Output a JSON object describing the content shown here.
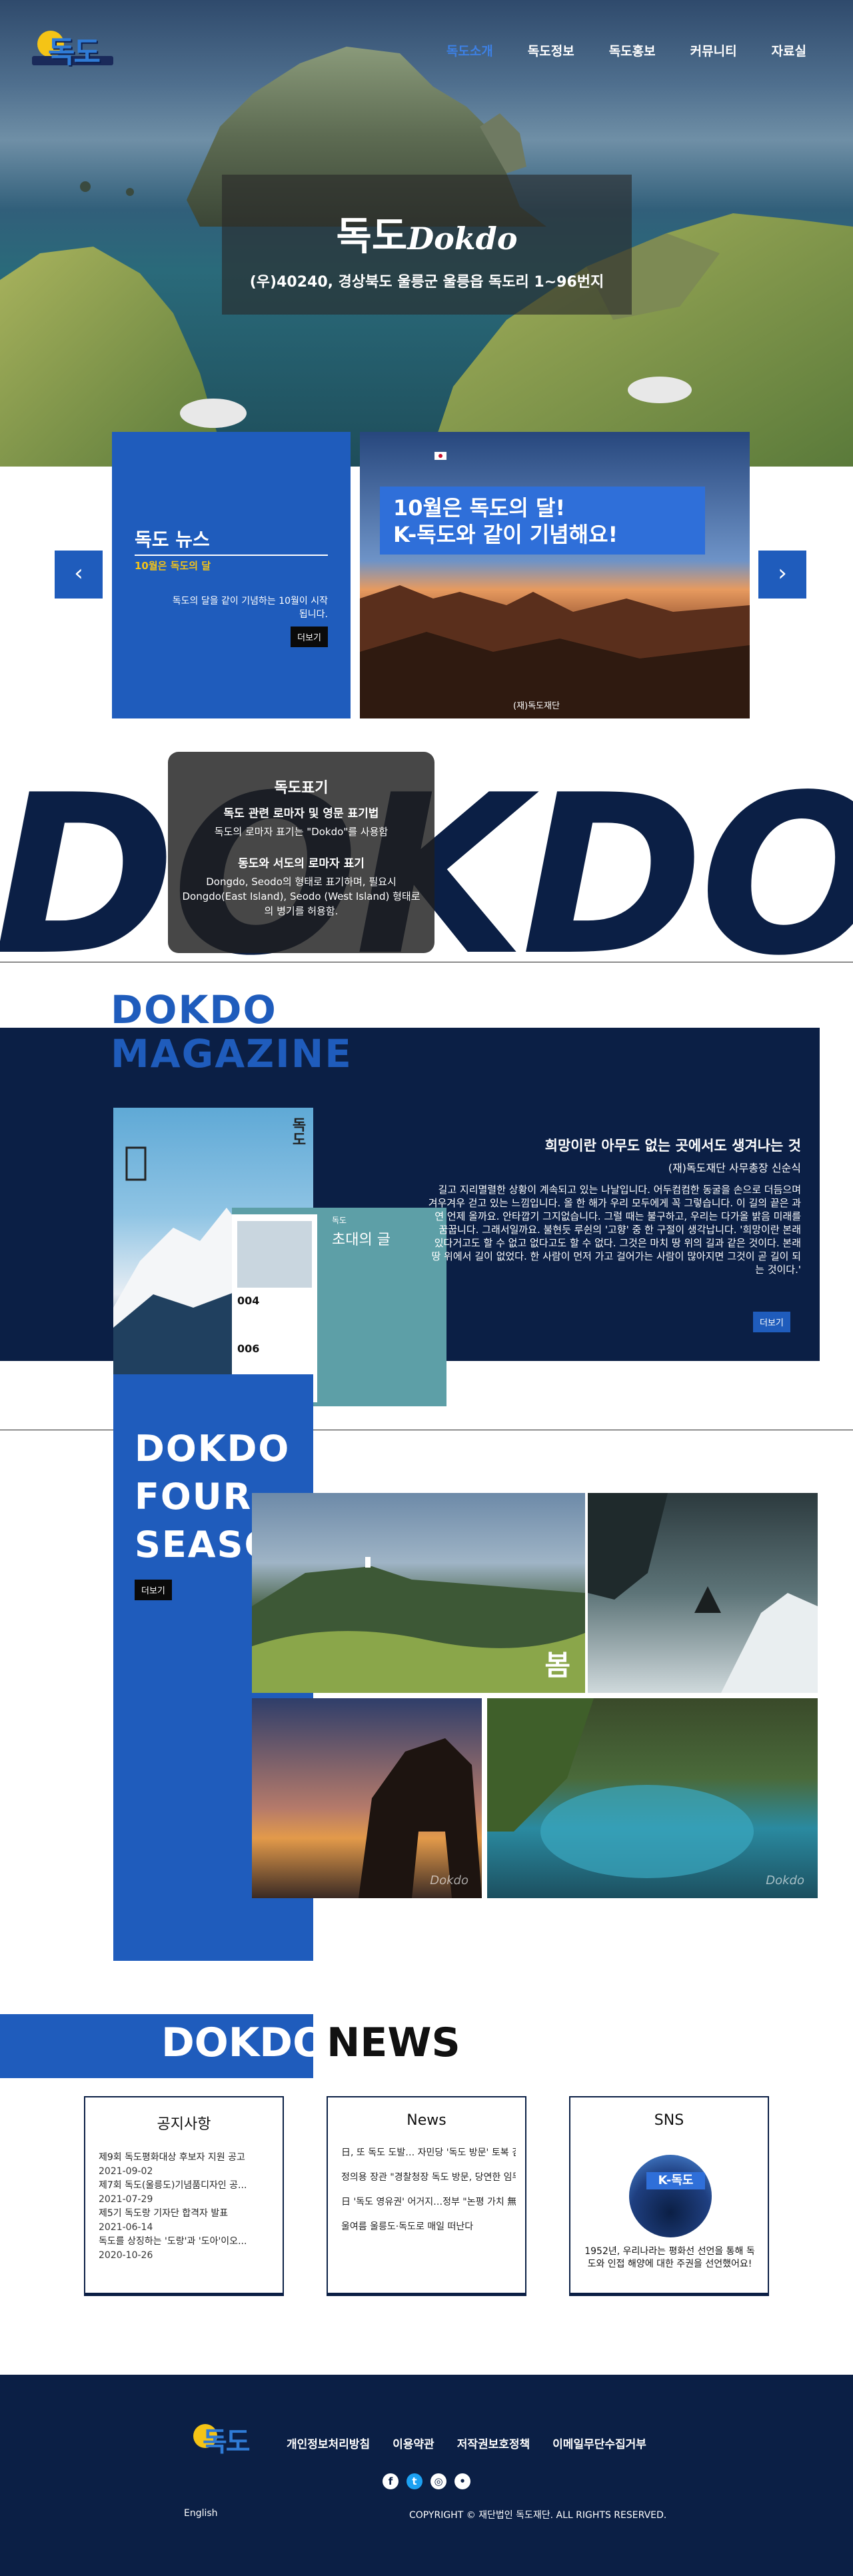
{
  "header": {
    "logo_text": "독도",
    "nav": [
      "독도소개",
      "독도정보",
      "독도홍보",
      "커뮤니티",
      "자료실"
    ],
    "nav_active": 0
  },
  "hero": {
    "title_ko": "독도",
    "title_en": "Dokdo",
    "address": "(우)40240, 경상북도 울릉군 울릉읍 독도리 1~96번지"
  },
  "news_slider": {
    "title": "독도 뉴스",
    "subtitle": "10월은 독도의 달",
    "description": "독도의 달을 같이 기념하는 10월이 시작됩니다.",
    "more_label": "더보기",
    "banner_line1": "10월은 독도의 달!",
    "banner_line2": "K-독도와 같이 기념해요!",
    "photo_credit": "(재)독도재단",
    "prev_icon": "chevron-left-icon",
    "next_icon": "chevron-right-icon"
  },
  "notation": {
    "brush_text": "DOKDO",
    "heading": "독도표기",
    "sub1": "독도 관련 로마자 및 영문 표기법",
    "body1": "독도의 로마자 표기는 \"Dokdo\"를 사용함",
    "sub2": "동도와 서도의 로마자 표기",
    "body2": "Dongdo, Seodo의 형태로 표기하며, 필요시 Dongdo(East Island), Seodo (West Island) 형태로의 병기를 허용함."
  },
  "magazine": {
    "title_line1": "DOKDO",
    "title_line2": "MAGAZINE",
    "cover_label": "독도",
    "page_small": "독도",
    "page_title": "초대의 글",
    "page_num1": "004",
    "page_num2": "006",
    "headline": "희망이란 아무도 없는 곳에서도 생겨나는 것",
    "author": "(재)독도재단 사무총장 신순식",
    "body": "길고 지리멸렬한 상황이 계속되고 있는 나날입니다. 어두컴컴한 동굴을 손으로 더듬으며 겨우겨우 걷고 있는 느낌입니다. 올 한 해가 우리 모두에게 꼭 그렇습니다. 이 길의 끝은 과연 언제 올까요. 안타깝기 그지없습니다. 그럴 때는 불구하고, 우리는 다가올 밝음 미래를 꿈꿉니다. 그래서일까요. 불현듯 루쉰의 '고향' 중 한 구절이 생각납니다. '희망이란 본래 있다거고도 할 수 없고 없다고도 할 수 없다. 그것은 마치 땅 위의 길과 같은 것이다. 본래 땅 위에서 길이 없었다. 한 사람이 먼저 가고 걸어가는 사람이 많아지면 그것이 곧 길이 되는 것이다.'",
    "more_label": "더보기"
  },
  "season": {
    "title_line1": "DOKDO",
    "title_line2": "FOUR",
    "title_line3": "SEASON",
    "more_label": "더보기",
    "spring_label": "봄",
    "watermark": "Dokdo"
  },
  "dokdo_news": {
    "title_a": "DOKDO",
    "title_b": "NEWS",
    "notice": {
      "title": "공지사항",
      "items": [
        {
          "text": "제9회 독도평화대상 후보자 지원 공고",
          "date": "2021-09-02"
        },
        {
          "text": "제7회 독도(울릉도)기념품디자인 공...",
          "date": "2021-07-29"
        },
        {
          "text": "제5기 독도랑 기자단 합격자 발표",
          "date": "2021-06-14"
        },
        {
          "text": "독도를 상징하는 '도랑'과 '도아'이오...",
          "date": "2020-10-26"
        }
      ]
    },
    "news": {
      "title": "News",
      "items": [
        "日, 또 독도 도발… 자민당 '독도 방문' 토복 검토",
        "정의용 장관 \"경찰청장 독도 방문, 당연한 임무수행\"",
        "日 '독도 영유권' 어거지…정부 \"논평 가치 無\" 일",
        "울여름 울릉도·독도로 매일 떠난다"
      ]
    },
    "sns": {
      "title": "SNS",
      "image_label": "K-독도",
      "text": "1952년, 우리나라는 평화선 선언을 통해 독도와 인접 해양에 대한 주권을 선언했어요!"
    }
  },
  "footer": {
    "logo_text": "독도",
    "links": [
      "개인정보처리방침",
      "이용약관",
      "저작권보호정책",
      "이메일무단수집거부"
    ],
    "social_icons": [
      "facebook-icon",
      "twitter-icon",
      "instagram-icon",
      "chat-icon"
    ],
    "language": "English",
    "copyright": "COPYRIGHT © 재단법인 독도재단. ALL RIGHTS RESERVED."
  },
  "colors": {
    "primary_blue": "#1f5cbc",
    "navy": "#0b1f45",
    "accent_yellow": "#f5c416",
    "nav_active": "#3d80e4"
  }
}
